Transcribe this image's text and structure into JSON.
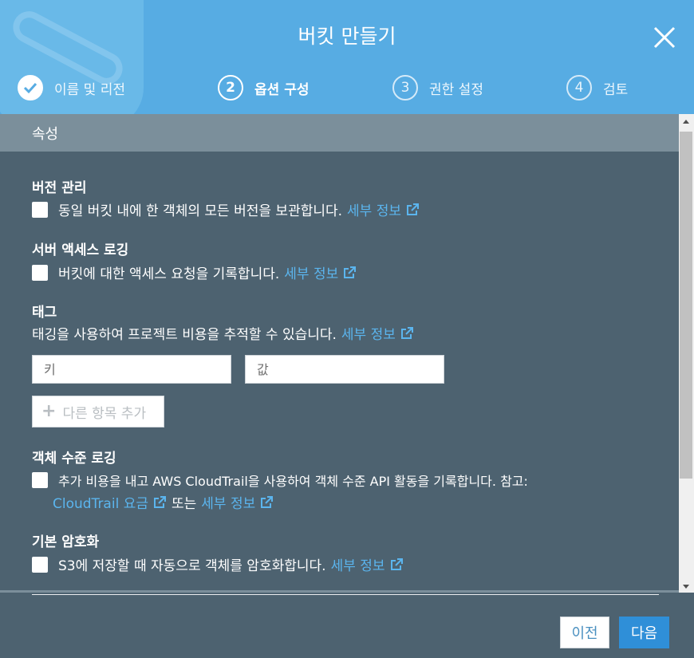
{
  "header": {
    "title": "버킷 만들기",
    "close_icon": "close-icon",
    "background_color": "#57ace3"
  },
  "steps": [
    {
      "number": "1",
      "label": "이름 및 리전",
      "state": "done",
      "icon": "check-icon"
    },
    {
      "number": "2",
      "label": "옵션 구성",
      "state": "active"
    },
    {
      "number": "3",
      "label": "권한 설정",
      "state": "pending"
    },
    {
      "number": "4",
      "label": "검토",
      "state": "pending"
    }
  ],
  "section": {
    "title": "속성"
  },
  "versioning": {
    "title": "버전 관리",
    "text": "동일 버킷 내에 한 객체의 모든 버전을 보관합니다.",
    "link": "세부 정보",
    "checked": false
  },
  "server_logging": {
    "title": "서버 액세스 로깅",
    "text": "버킷에 대한 액세스 요청을 기록합니다.",
    "link": "세부 정보",
    "checked": false
  },
  "tags": {
    "title": "태그",
    "text": "태깅을 사용하여 프로젝트 비용을 추적할 수 있습니다.",
    "link": "세부 정보",
    "key_placeholder": "키",
    "value_placeholder": "값",
    "add_button": "다른 항목 추가"
  },
  "object_logging": {
    "title": "객체 수준 로깅",
    "text": "추가 비용을 내고 AWS CloudTrail을 사용하여 객체 수준 API 활동을 기록합니다. 참고:",
    "pricing_link": "CloudTrail 요금",
    "or": "또는",
    "link": "세부 정보",
    "checked": false
  },
  "encryption": {
    "title": "기본 암호화",
    "text": "S3에 저장할 때 자동으로 객체를 암호화합니다.",
    "link": "세부 정보",
    "checked": false
  },
  "footer": {
    "prev_label": "이전",
    "next_label": "다음",
    "next_color": "#2f8fd8"
  },
  "colors": {
    "link": "#5bb5ee",
    "body_bg": "#4d6270",
    "section_bar": "#7b8f9b"
  }
}
